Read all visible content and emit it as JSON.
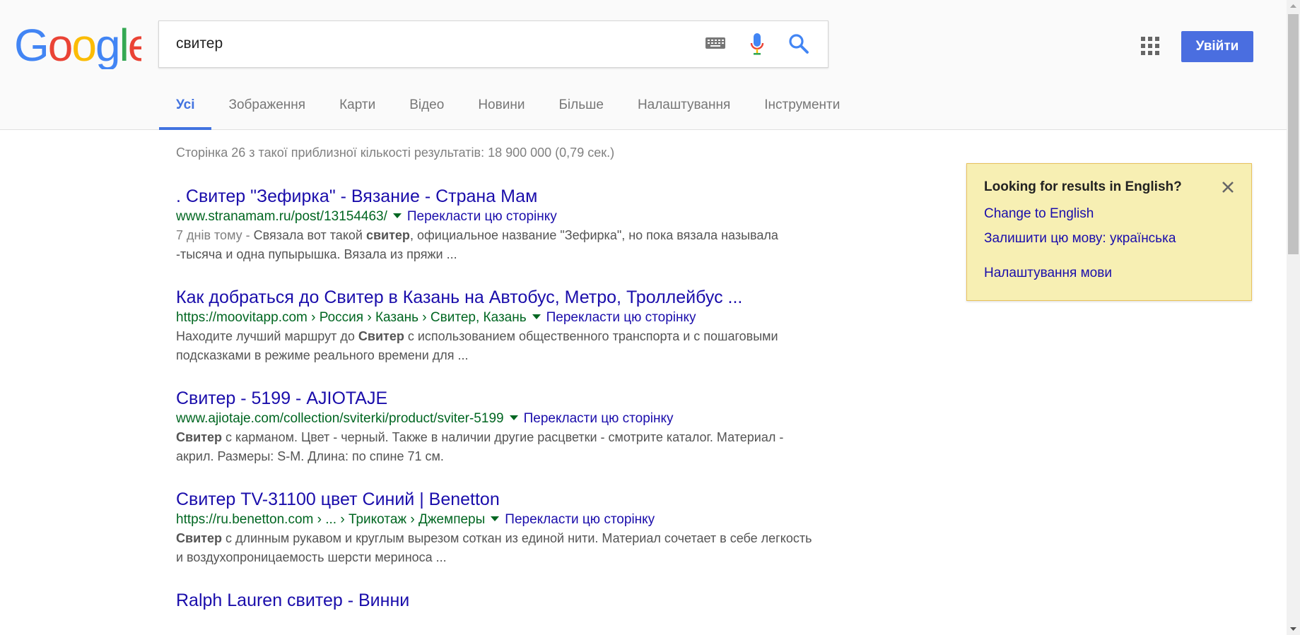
{
  "search": {
    "query": "свитер"
  },
  "header": {
    "signin_label": "Увійти"
  },
  "tabs": [
    {
      "label": "Усі",
      "active": true
    },
    {
      "label": "Зображення"
    },
    {
      "label": "Карти"
    },
    {
      "label": "Відео"
    },
    {
      "label": "Новини"
    },
    {
      "label": "Більше"
    },
    {
      "label": "Налаштування"
    },
    {
      "label": "Інструменти"
    }
  ],
  "stats": "Сторінка 26 з такої приблизної кількості результатів: 18 900 000 (0,79 сек.)",
  "translate_label": "Перекласти цю сторінку",
  "results": [
    {
      "title": ". Свитер \"Зефирка\" - Вязание - Страна Мам",
      "url": "www.stranamam.ru/post/13154463/",
      "date": "7 днів тому - ",
      "snippet_parts": [
        "Связала вот такой ",
        "свитер",
        ", официальное название \"Зефирка\", но пока вязала называла -тысяча и одна пупырышка. Вязала из пряжи ..."
      ]
    },
    {
      "title": "Как добраться до Свитер в Казань на Автобус, Метро, Троллейбус ...",
      "url": "https://moovitapp.com › Россия › Казань › Свитер, Казань",
      "snippet_parts": [
        "Находите лучший маршрут до ",
        "Свитер",
        " с использованием общественного транспорта и с пошаговыми подсказками в режиме реального времени для ..."
      ]
    },
    {
      "title": "Свитер - 5199 - AJIOTAJE",
      "url": "www.ajiotaje.com/collection/sviterki/product/sviter-5199",
      "snippet_parts": [
        "",
        "Свитер",
        " с карманом. Цвет - черный. Также в наличии другие расцветки - смотрите каталог. Материал - акрил. Размеры: S-M. Длина: по спине 71 см."
      ]
    },
    {
      "title": "Свитер TV-31100 цвет Синий | Benetton",
      "url": "https://ru.benetton.com › ... › Трикотаж › Джемперы",
      "snippet_parts": [
        "",
        "Свитер",
        " с длинным рукавом и круглым вырезом соткан из единой нити. Материал сочетает в себе легкость и воздухопроницаемость шерсти мериноса ..."
      ]
    },
    {
      "title": "Ralph Lauren свитер - Винни"
    }
  ],
  "lang_box": {
    "title": "Looking for results in English?",
    "change": "Change to English",
    "keep": "Залишити цю мову: українська",
    "settings": "Налаштування мови"
  }
}
